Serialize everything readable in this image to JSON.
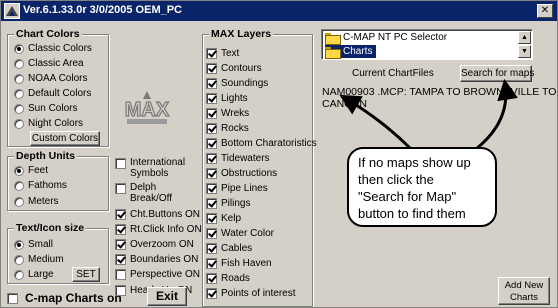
{
  "window": {
    "title": "Ver.6.1.33.0r 3/0/2005 OEM_PC",
    "close_glyph": "✕"
  },
  "chart_colors": {
    "title": "Chart Colors",
    "options": [
      {
        "label": "Classic Colors",
        "selected": true
      },
      {
        "label": "Classic Area",
        "selected": false
      },
      {
        "label": "NOAA Colors",
        "selected": false
      },
      {
        "label": "Default Colors",
        "selected": false
      },
      {
        "label": "Sun Colors",
        "selected": false
      },
      {
        "label": "Night Colors",
        "selected": false
      }
    ],
    "custom_button": "Custom Colors"
  },
  "depth_units": {
    "title": "Depth Units",
    "options": [
      {
        "label": "Feet",
        "selected": true
      },
      {
        "label": "Fathoms",
        "selected": false
      },
      {
        "label": "Meters",
        "selected": false
      }
    ]
  },
  "text_icon_size": {
    "title": "Text/Icon size",
    "options": [
      {
        "label": "Small",
        "selected": true
      },
      {
        "label": "Medium",
        "selected": false
      },
      {
        "label": "Large",
        "selected": false
      }
    ],
    "set_button": "SET"
  },
  "logo": {
    "icon": "max-logo"
  },
  "settings": [
    {
      "label": "International\nSymbols",
      "checked": false
    },
    {
      "label": "Delph\nBreak/Off",
      "checked": false
    },
    {
      "label": "Cht.Buttons ON",
      "checked": true
    },
    {
      "label": "Rt.Click Info ON",
      "checked": true
    },
    {
      "label": "Overzoom ON",
      "checked": true
    },
    {
      "label": "Boundaries ON",
      "checked": true
    },
    {
      "label": "Perspective ON",
      "checked": false
    },
    {
      "label": "Heads Up ON",
      "checked": false
    }
  ],
  "exit_button": "Exit",
  "cmap_charts_on": {
    "label": "C-map Charts on",
    "checked": false
  },
  "max_layers": {
    "title": "MAX Layers",
    "items": [
      {
        "label": "Text",
        "checked": true
      },
      {
        "label": "Contours",
        "checked": true
      },
      {
        "label": "Soundings",
        "checked": true
      },
      {
        "label": "Lights",
        "checked": true
      },
      {
        "label": "Wreks",
        "checked": true
      },
      {
        "label": "Rocks",
        "checked": true
      },
      {
        "label": "Bottom Charatoristics",
        "checked": true
      },
      {
        "label": "Tidewaters",
        "checked": true
      },
      {
        "label": "Obstructions",
        "checked": true
      },
      {
        "label": "Pipe Lines",
        "checked": true
      },
      {
        "label": "Pilings",
        "checked": true
      },
      {
        "label": "Kelp",
        "checked": true
      },
      {
        "label": "Water Color",
        "checked": true
      },
      {
        "label": "Cables",
        "checked": true
      },
      {
        "label": "Fish Haven",
        "checked": true
      },
      {
        "label": "Roads",
        "checked": true
      },
      {
        "label": "Points of interest",
        "checked": true
      }
    ]
  },
  "chart_selector": {
    "items": [
      {
        "label": "C-MAP NT PC Selector",
        "icon": "folder-icon",
        "selected": false
      },
      {
        "label": "Charts",
        "icon": "folder-icon",
        "selected": true
      }
    ],
    "current_chart_files_label": "Current ChartFiles",
    "search_button": "Search for maps",
    "chart_file_line1": "NAM00903 .MCP: TAMPA TO BROWNSVILLE TO",
    "chart_file_line2": "CANCUN"
  },
  "callout": {
    "lines": [
      "If no maps show up",
      "then click the",
      "\"Search for Map\"",
      "button to find them"
    ]
  },
  "add_new_charts_button": "Add New\nCharts"
}
